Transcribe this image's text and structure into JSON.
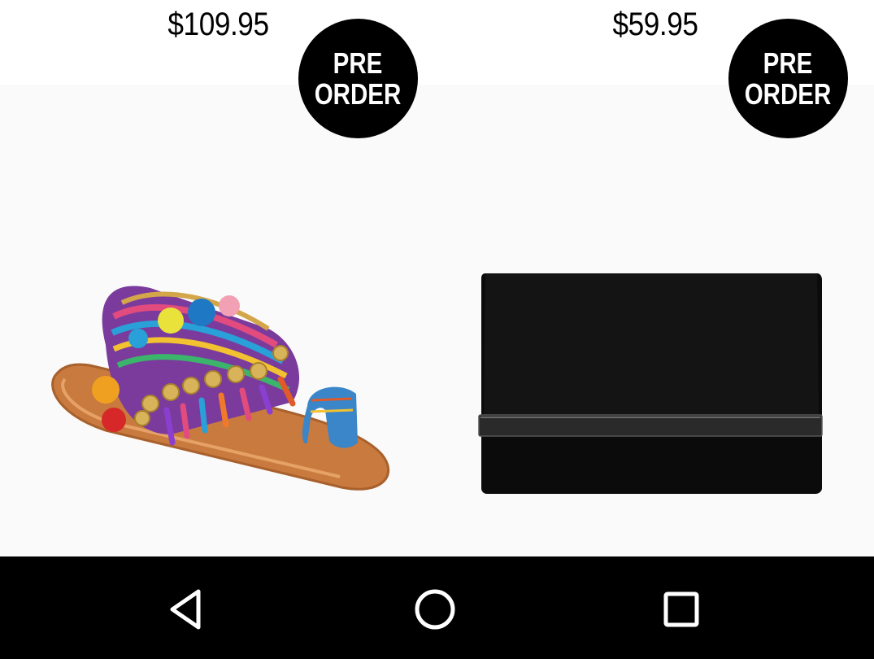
{
  "products": [
    {
      "price": "$109.95",
      "badge_line1": "PRE",
      "badge_line2": "ORDER",
      "image_icon": "sandal-image"
    },
    {
      "price": "$59.95",
      "badge_line1": "PRE",
      "badge_line2": "ORDER",
      "image_icon": "clutch-image"
    }
  ],
  "colors": {
    "badge_bg": "#000000",
    "badge_text": "#ffffff",
    "navbar_bg": "#000000",
    "nav_icon": "#ffffff"
  },
  "navbar": {
    "icons": [
      "back-icon",
      "home-icon",
      "recents-icon"
    ]
  }
}
